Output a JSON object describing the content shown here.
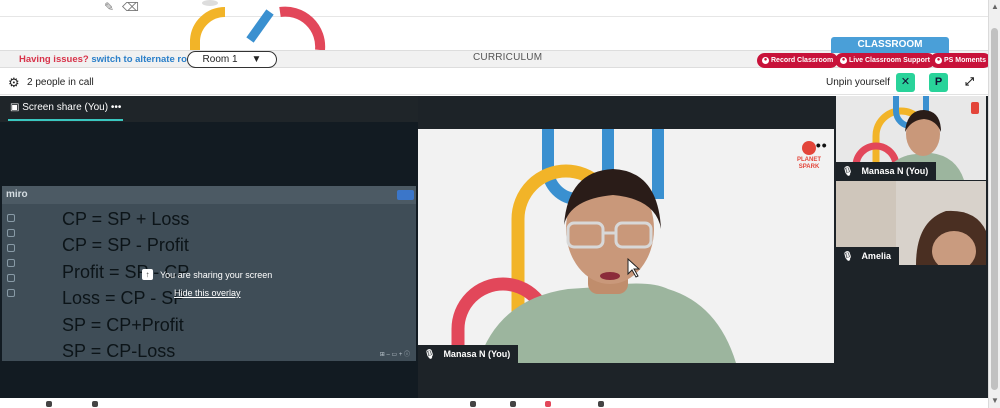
{
  "room_bar": {
    "issues_text": "Having issues?",
    "switch_link": "switch to alternate room",
    "room_selected": "Room 1",
    "curriculum": "CURRICULUM",
    "classroom_tab": "CLASSROOM",
    "record_button": "Record Classroom",
    "support_button": "Live Classroom Support",
    "moments_button": "PS Moments"
  },
  "call_header": {
    "people_count": "2 people in call",
    "unpin_label": "Unpin yourself",
    "avatar_letter": "P"
  },
  "screen_share": {
    "tab_title": "Screen share (You)",
    "tab_menu": "•••",
    "app_logo": "miro",
    "formulas": [
      "CP = SP + Loss",
      "CP = SP - Profit",
      "Profit = SP - CP",
      "Loss = CP - SP",
      "SP = CP+Profit",
      "SP = CP-Loss"
    ],
    "overlay_message": "You are sharing your screen",
    "overlay_hide": "Hide this overlay"
  },
  "main_video": {
    "participant": "Manasa N (You)",
    "menu": "•••",
    "logo_text_1": "PLANET",
    "logo_text_2": "SPARK"
  },
  "tiles": [
    {
      "participant": "Manasa N (You)"
    },
    {
      "participant": "Amelia"
    }
  ],
  "colors": {
    "accent_red": "#c8123a",
    "accent_blue": "#4a9fd8",
    "accent_green": "#29d39a",
    "stage_bg": "#1d2328"
  }
}
